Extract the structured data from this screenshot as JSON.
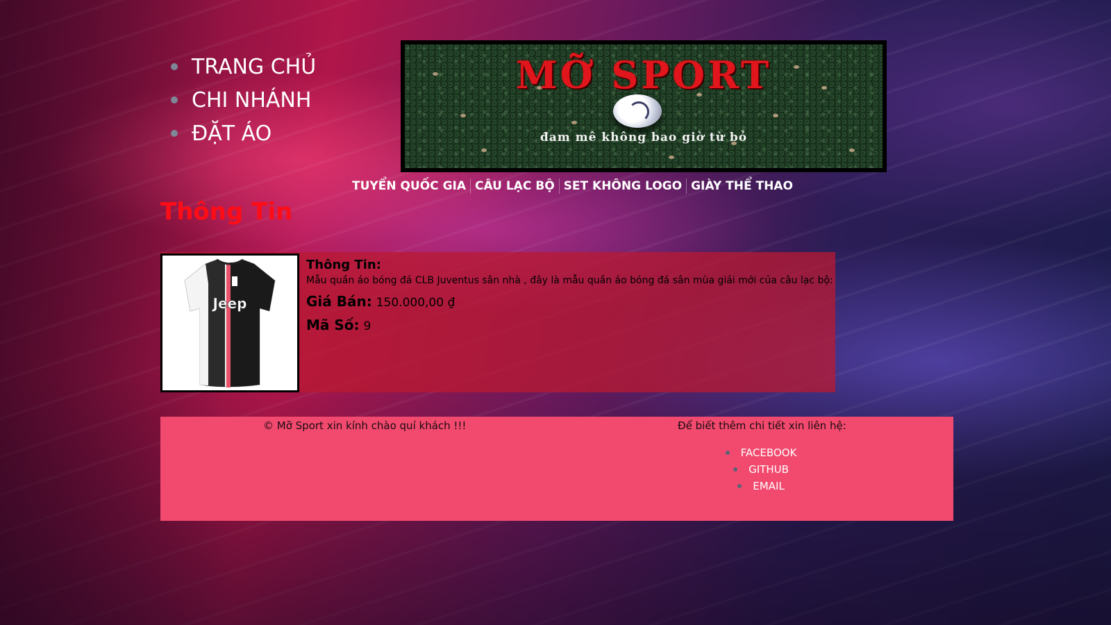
{
  "main_nav": {
    "items": [
      {
        "label": "TRANG CHỦ"
      },
      {
        "label": "CHI NHÁNH"
      },
      {
        "label": "ĐẶT ÁO"
      }
    ]
  },
  "banner": {
    "title": "MỠ SPORT",
    "slogan": "đam mê không bao giờ từ bỏ"
  },
  "category_nav": {
    "items": [
      {
        "label": "TUYỂN QUỐC GIA"
      },
      {
        "label": "CÂU LẠC BỘ"
      },
      {
        "label": "SET KHÔNG LOGO"
      },
      {
        "label": "GIÀY THỂ THAO"
      }
    ]
  },
  "section": {
    "title": "Thông Tin"
  },
  "product": {
    "image_alt": "Juventus home jersey",
    "jersey_text": "Jeep",
    "info_heading": "Thông Tin:",
    "description": "Mẫu quần áo bóng đá CLB Juventus sân nhà , đây là mẫu quần áo bóng đá sân mùa giải mới của câu lạc bộ:",
    "price_label": "Giá Bán:",
    "price_value": "150.000,00 ₫",
    "code_label": "Mã Số:",
    "code_value": "9"
  },
  "footer": {
    "greeting": "© Mỡ Sport xin kính chào quí khách !!!",
    "contact_heading": "Để biết thêm chi tiết xin liên hệ:",
    "links": [
      {
        "label": "FACEBOOK"
      },
      {
        "label": "GITHUB"
      },
      {
        "label": "EMAIL"
      }
    ]
  },
  "colors": {
    "section_title": "#ff0d16",
    "footer_bg": "#f24a6e",
    "card_bg": "#b91a32"
  }
}
